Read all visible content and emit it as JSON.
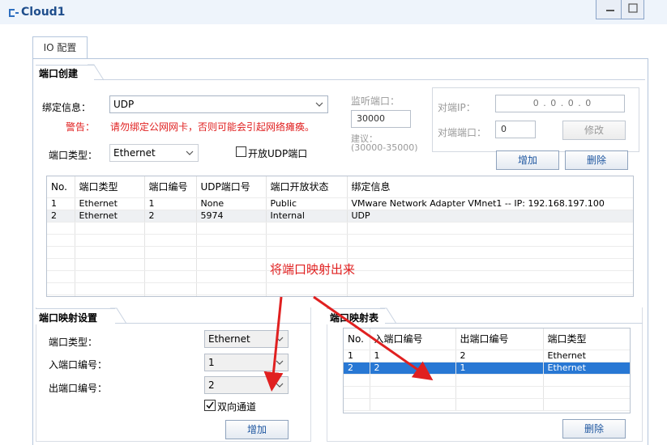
{
  "window": {
    "title": "Cloud1"
  },
  "tabs": [
    {
      "label": "IO 配置"
    }
  ],
  "port_create": {
    "section_title": "端口创建",
    "binding_label": "绑定信息：",
    "binding_value": "UDP",
    "warning_label": "警告：",
    "warning_text": "请勿绑定公网网卡，否则可能会引起网络瘫痪。",
    "port_type_label": "端口类型：",
    "port_type_value": "Ethernet",
    "open_udp_label": "开放UDP端口",
    "listen_port_label": "监听端口：",
    "listen_port_value": "30000",
    "suggest_label": "建议：",
    "suggest_range": "(30000-35000)",
    "peer_ip_label": "对端IP：",
    "peer_ip_value": "0 . 0 . 0 . 0",
    "peer_port_label": "对端端口：",
    "peer_port_value": "0",
    "modify_button": "修改",
    "add_button": "增加",
    "delete_button": "删除",
    "table": {
      "headers": [
        "No.",
        "端口类型",
        "端口编号",
        "UDP端口号",
        "端口开放状态",
        "绑定信息"
      ],
      "rows": [
        [
          "1",
          "Ethernet",
          "1",
          "None",
          "Public",
          "VMware Network Adapter VMnet1 -- IP: 192.168.197.100"
        ],
        [
          "2",
          "Ethernet",
          "2",
          "5974",
          "Internal",
          "UDP"
        ]
      ]
    }
  },
  "annotation": {
    "text": "将端口映射出来"
  },
  "mapping_settings": {
    "section_title": "端口映射设置",
    "port_type_label": "端口类型：",
    "port_type_value": "Ethernet",
    "in_port_label": "入端口编号：",
    "in_port_value": "1",
    "out_port_label": "出端口编号：",
    "out_port_value": "2",
    "bidirectional_label": "双向通道",
    "bidirectional_checked": true,
    "add_button": "增加"
  },
  "mapping_table": {
    "section_title": "端口映射表",
    "headers": [
      "No.",
      "入端口编号",
      "出端口编号",
      "端口类型"
    ],
    "rows": [
      [
        "1",
        "1",
        "2",
        "Ethernet"
      ],
      [
        "2",
        "2",
        "1",
        "Ethernet"
      ]
    ],
    "delete_button": "删除"
  },
  "colors": {
    "selection": "#2878d4",
    "annotation": "#e02020",
    "title": "#1f4e8c"
  }
}
